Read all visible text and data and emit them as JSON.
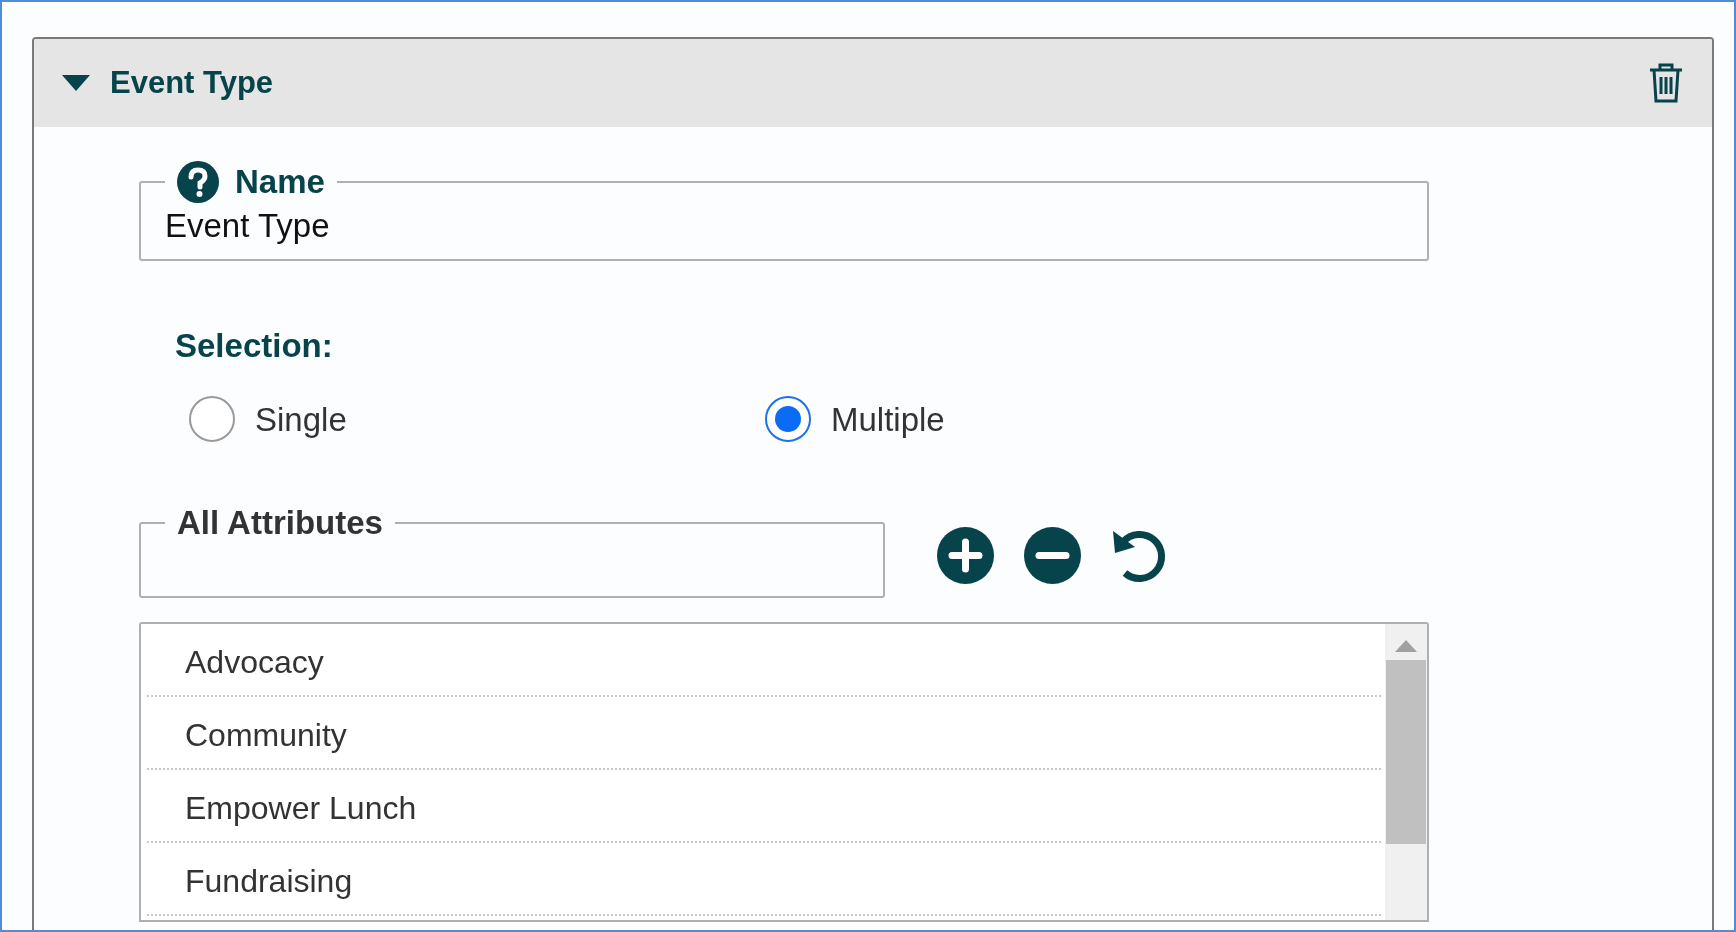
{
  "panel": {
    "title": "Event Type",
    "expanded": true
  },
  "name_field": {
    "label": "Name",
    "value": "Event Type"
  },
  "selection": {
    "label": "Selection:",
    "options": [
      {
        "label": "Single",
        "selected": false
      },
      {
        "label": "Multiple",
        "selected": true
      }
    ]
  },
  "attributes": {
    "label": "All Attributes"
  },
  "items": [
    {
      "label": "Advocacy"
    },
    {
      "label": "Community"
    },
    {
      "label": "Empower Lunch"
    },
    {
      "label": "Fundraising"
    }
  ]
}
